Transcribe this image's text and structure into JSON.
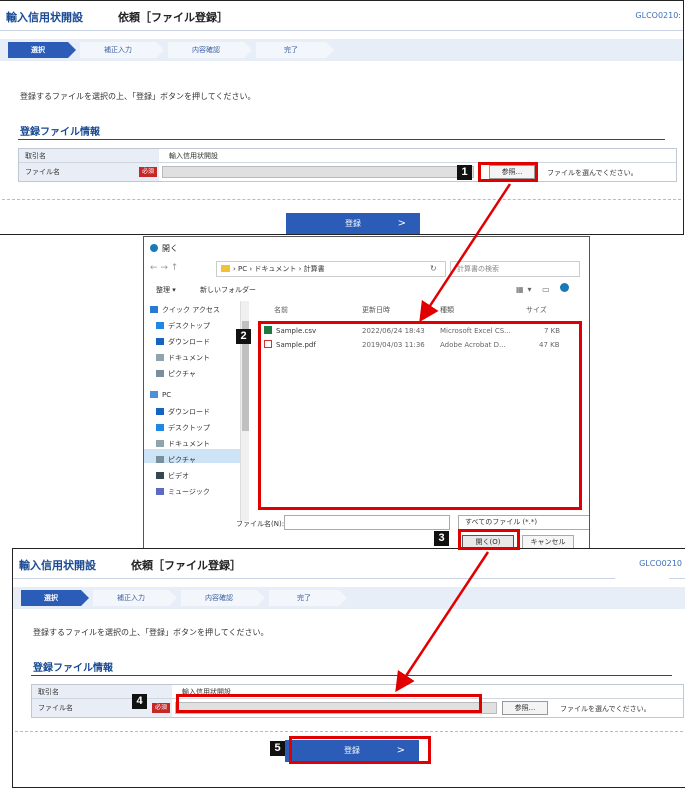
{
  "colors": {
    "accent": "#2a5cb8",
    "title": "#1a4a93",
    "required": "#c62828",
    "callout": "#e00000"
  },
  "screen_top": {
    "app_name": "輸入信用状開設",
    "page_title": "依頼［ファイル登録］",
    "screen_code": "GLCO0210:",
    "steps": [
      "選択",
      "補正入力",
      "内容確認",
      "完了"
    ],
    "message": "登録するファイルを選択の上、「登録」ボタンを押してください。",
    "section_title": "登録ファイル情報",
    "row1_label": "取引名",
    "row1_value": "輸入信用状開設",
    "row2_label": "ファイル名",
    "required_badge": "必須",
    "browse_label": "参照...",
    "hint": "ファイルを選んでください。",
    "register_label": "登録"
  },
  "dialog": {
    "title": "開く",
    "nav_arrows": "←  →  ↑",
    "path": "› PC › ドキュメント › 計算書",
    "search_placeholder": "計算書の検索",
    "organize": "整理 ▾",
    "new_folder": "新しいフォルダー",
    "sidebar": [
      "クイック アクセス",
      "デスクトップ",
      "ダウンロード",
      "ドキュメント",
      "ピクチャ",
      "PC",
      "ダウンロード",
      "デスクトップ",
      "ドキュメント",
      "ピクチャ",
      "ビデオ",
      "ミュージック"
    ],
    "columns": [
      "名前",
      "更新日時",
      "種類",
      "サイズ"
    ],
    "files": [
      {
        "name": "Sample.csv",
        "modified": "2022/06/24 18:43",
        "type": "Microsoft Excel CS...",
        "size": "7 KB",
        "icon": "excel-icon"
      },
      {
        "name": "Sample.pdf",
        "modified": "2019/04/03 11:36",
        "type": "Adobe Acrobat D...",
        "size": "47 KB",
        "icon": "pdf-icon"
      }
    ],
    "filename_label": "ファイル名(N):",
    "filetype": "すべてのファイル (*.*)",
    "open_label": "開く(O)",
    "cancel_label": "キャンセル"
  },
  "screen_bottom": {
    "app_name": "輸入信用状開設",
    "page_title": "依頼［ファイル登録］",
    "screen_code": "GLCO0210",
    "steps": [
      "選択",
      "補正入力",
      "内容確認",
      "完了"
    ],
    "message": "登録するファイルを選択の上、「登録」ボタンを押してください。",
    "section_title": "登録ファイル情報",
    "row1_label": "取引名",
    "row1_value": "輸入信用状開設",
    "row2_label": "ファイル名",
    "required_badge": "必須",
    "browse_label": "参照...",
    "hint": "ファイルを選んでください。",
    "register_label": "登録"
  },
  "callouts": [
    "1",
    "2",
    "3",
    "4",
    "5"
  ]
}
